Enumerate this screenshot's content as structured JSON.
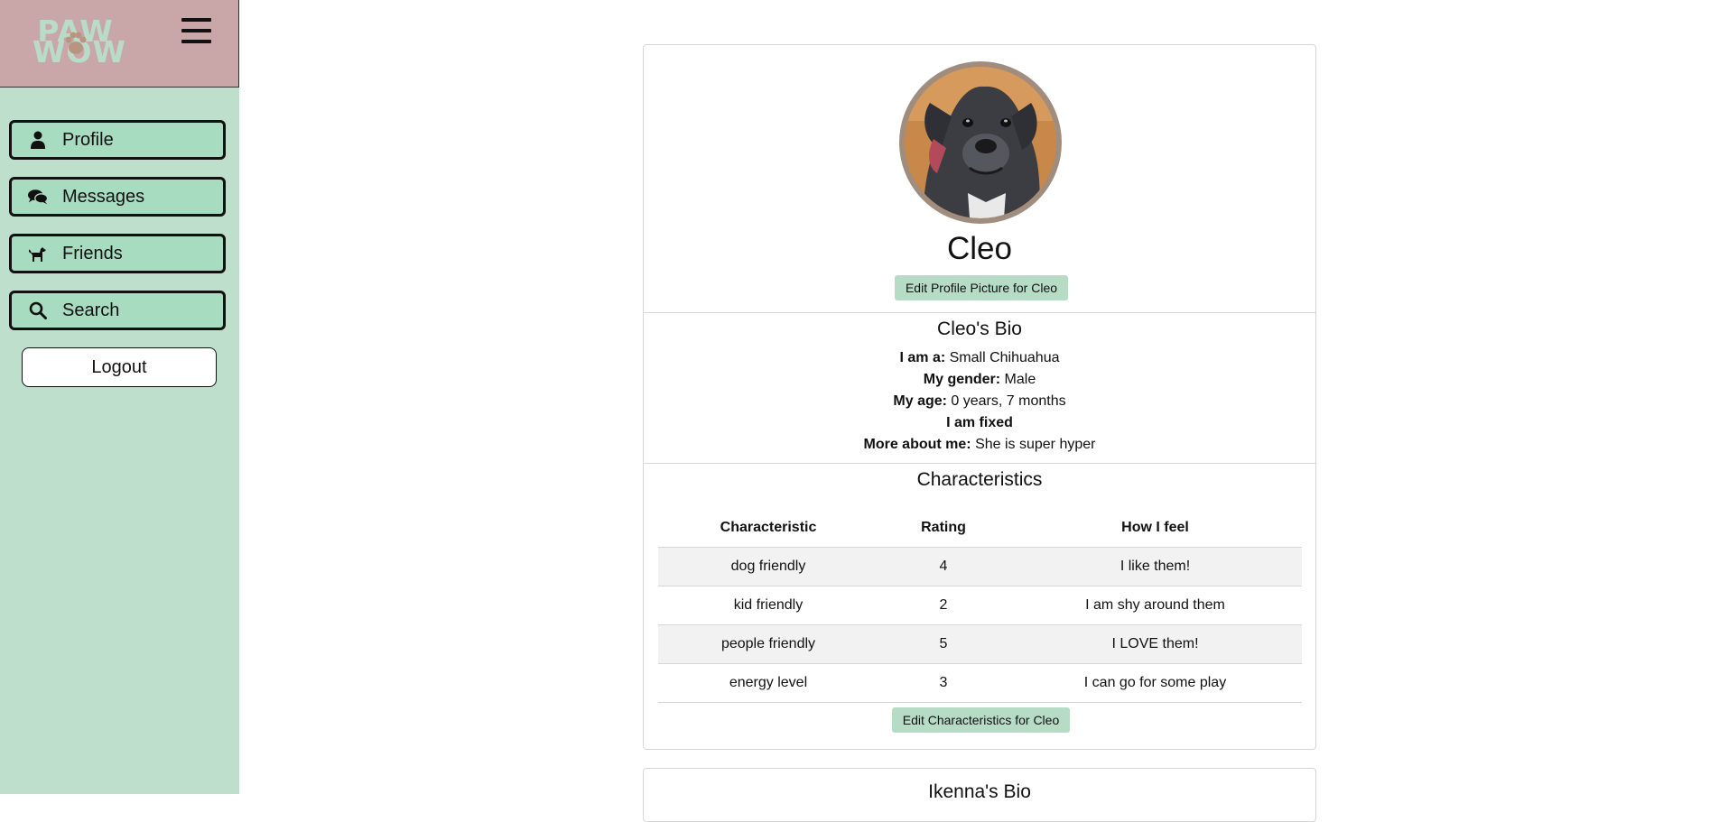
{
  "brand": {
    "logo_line1": "PAW",
    "logo_line2": "WOW"
  },
  "nav": [
    {
      "label": "Profile",
      "icon": "person-icon"
    },
    {
      "label": "Messages",
      "icon": "chat-bubbles-icon"
    },
    {
      "label": "Friends",
      "icon": "dog-icon"
    },
    {
      "label": "Search",
      "icon": "search-icon"
    }
  ],
  "logout_label": "Logout",
  "profile": {
    "name": "Cleo",
    "edit_picture_label": "Edit Profile Picture for Cleo",
    "bio_title": "Cleo's Bio",
    "bio": [
      {
        "label": "I am a:",
        "value": " Small Chihuahua"
      },
      {
        "label": "My gender:",
        "value": " Male"
      },
      {
        "label": "My age:",
        "value": " 0 years, 7 months"
      },
      {
        "label": "I am fixed",
        "value": ""
      },
      {
        "label": "More about me:",
        "value": " She is super hyper"
      }
    ],
    "characteristics_title": "Characteristics",
    "columns": [
      "Characteristic",
      "Rating",
      "How I feel"
    ],
    "rows": [
      [
        "dog friendly",
        "4",
        "I like them!"
      ],
      [
        "kid friendly",
        "2",
        "I am shy around them"
      ],
      [
        "people friendly",
        "5",
        "I LOVE them!"
      ],
      [
        "energy level",
        "3",
        "I can go for some play"
      ]
    ],
    "edit_characteristics_label": "Edit Characteristics for Cleo"
  },
  "next_card": {
    "title": "Ikenna's Bio"
  },
  "colors": {
    "sidebar": "#bddfcc",
    "brand_bg": "#c9a7a9",
    "nav_button": "#a8dcc0",
    "small_button": "#b6dcc6",
    "table_stripe": "#f2f2f2"
  }
}
